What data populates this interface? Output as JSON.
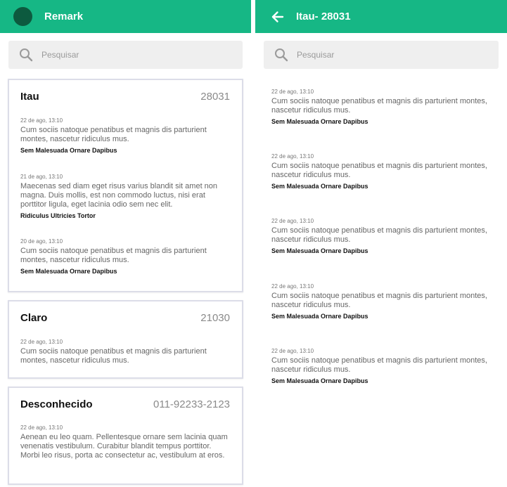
{
  "left": {
    "appbar": {
      "title": "Remark"
    },
    "search": {
      "placeholder": "Pesquisar"
    },
    "cards": [
      {
        "name": "Itau",
        "number": "28031",
        "entries": [
          {
            "date": "22 de ago, 13:10",
            "text": "Cum sociis natoque penatibus et magnis dis parturient montes, nascetur ridiculus mus.",
            "signature": "Sem Malesuada Ornare Dapibus"
          },
          {
            "date": "21 de ago, 13:10",
            "text": "Maecenas sed diam eget risus varius blandit sit amet non magna. Duis mollis, est non commodo luctus, nisi erat porttitor ligula, eget lacinia odio sem nec elit.",
            "signature": "Ridiculus Ultricies Tortor"
          },
          {
            "date": "20 de ago, 13:10",
            "text": "Cum sociis natoque penatibus et magnis dis parturient montes, nascetur ridiculus mus.",
            "signature": "Sem Malesuada Ornare Dapibus"
          }
        ]
      },
      {
        "name": "Claro",
        "number": "21030",
        "entries": [
          {
            "date": "22 de ago, 13:10",
            "text": "Cum sociis natoque penatibus et magnis dis parturient montes, nascetur ridiculus mus."
          }
        ]
      },
      {
        "name": "Desconhecido",
        "number": "011-92233-2123",
        "entries": [
          {
            "date": "22 de ago, 13:10",
            "text": "Aenean eu leo quam. Pellentesque ornare sem lacinia quam venenatis vestibulum. Curabitur blandit tempus porttitor. Morbi leo risus, porta ac consectetur ac, vestibulum at eros."
          }
        ]
      }
    ]
  },
  "right": {
    "appbar": {
      "title": "Itau- 28031"
    },
    "search": {
      "placeholder": "Pesquisar"
    },
    "messages": [
      {
        "date": "22 de ago, 13:10",
        "text": "Cum sociis natoque penatibus et magnis dis parturient montes, nascetur ridiculus mus.",
        "signature": "Sem Malesuada Ornare Dapibus"
      },
      {
        "date": "22 de ago, 13:10",
        "text": "Cum sociis natoque penatibus et magnis dis parturient montes, nascetur ridiculus mus.",
        "signature": "Sem Malesuada Ornare Dapibus"
      },
      {
        "date": "22 de ago, 13:10",
        "text": "Cum sociis natoque penatibus et magnis dis parturient montes, nascetur ridiculus mus.",
        "signature": "Sem Malesuada Ornare Dapibus"
      },
      {
        "date": "22 de ago, 13:10",
        "text": "Cum sociis natoque penatibus et magnis dis parturient montes, nascetur ridiculus mus.",
        "signature": "Sem Malesuada Ornare Dapibus"
      },
      {
        "date": "22 de ago, 13:10",
        "text": "Cum sociis natoque penatibus et magnis dis parturient montes, nascetur ridiculus mus.",
        "signature": "Sem Malesuada Ornare Dapibus"
      }
    ]
  },
  "colors": {
    "accent": "#16b785",
    "avatar": "#0d5a3f",
    "search_bg": "#efefef",
    "card_border": "#dcdde8"
  },
  "icons": {
    "search": "search-icon",
    "back": "arrow-back-icon",
    "avatar": "avatar"
  }
}
